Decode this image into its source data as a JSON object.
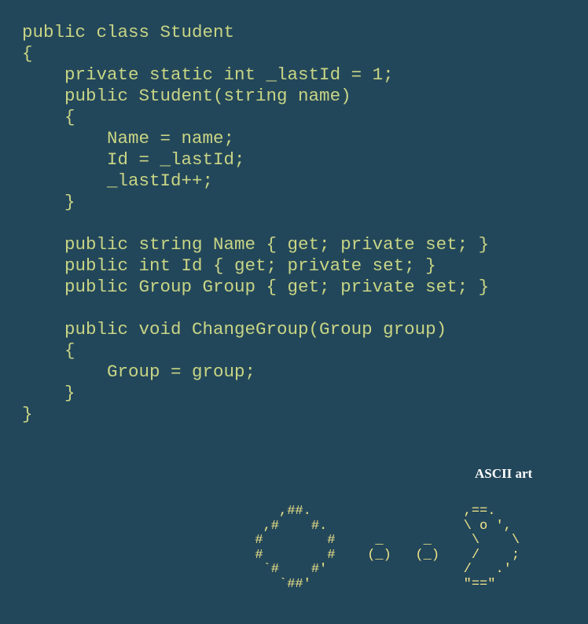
{
  "code": {
    "lines": [
      "public class Student",
      "{",
      "    private static int _lastId = 1;",
      "    public Student(string name)",
      "    {",
      "        Name = name;",
      "        Id = _lastId;",
      "        _lastId++;",
      "    }",
      "",
      "    public string Name { get; private set; }",
      "    public int Id { get; private set; }",
      "    public Group Group { get; private set; }",
      "",
      "    public void ChangeGroup(Group group)",
      "    {",
      "        Group = group;",
      "    }",
      "}"
    ]
  },
  "ascii_section": {
    "title": "ASCII art",
    "lines": [
      "     ,##.                   ,==.",
      "   ,#    #.                 \\ o ',",
      "  #        #     _     _     \\    \\",
      "  #        #    (_)   (_)    /    ;",
      "   `#    #'                 /   .'",
      "     `##'                   \"==\""
    ]
  },
  "colors": {
    "background": "#23475a",
    "code_text": "#c8d585",
    "ascii_text": "#efe58a",
    "title_text": "#ffffff"
  }
}
